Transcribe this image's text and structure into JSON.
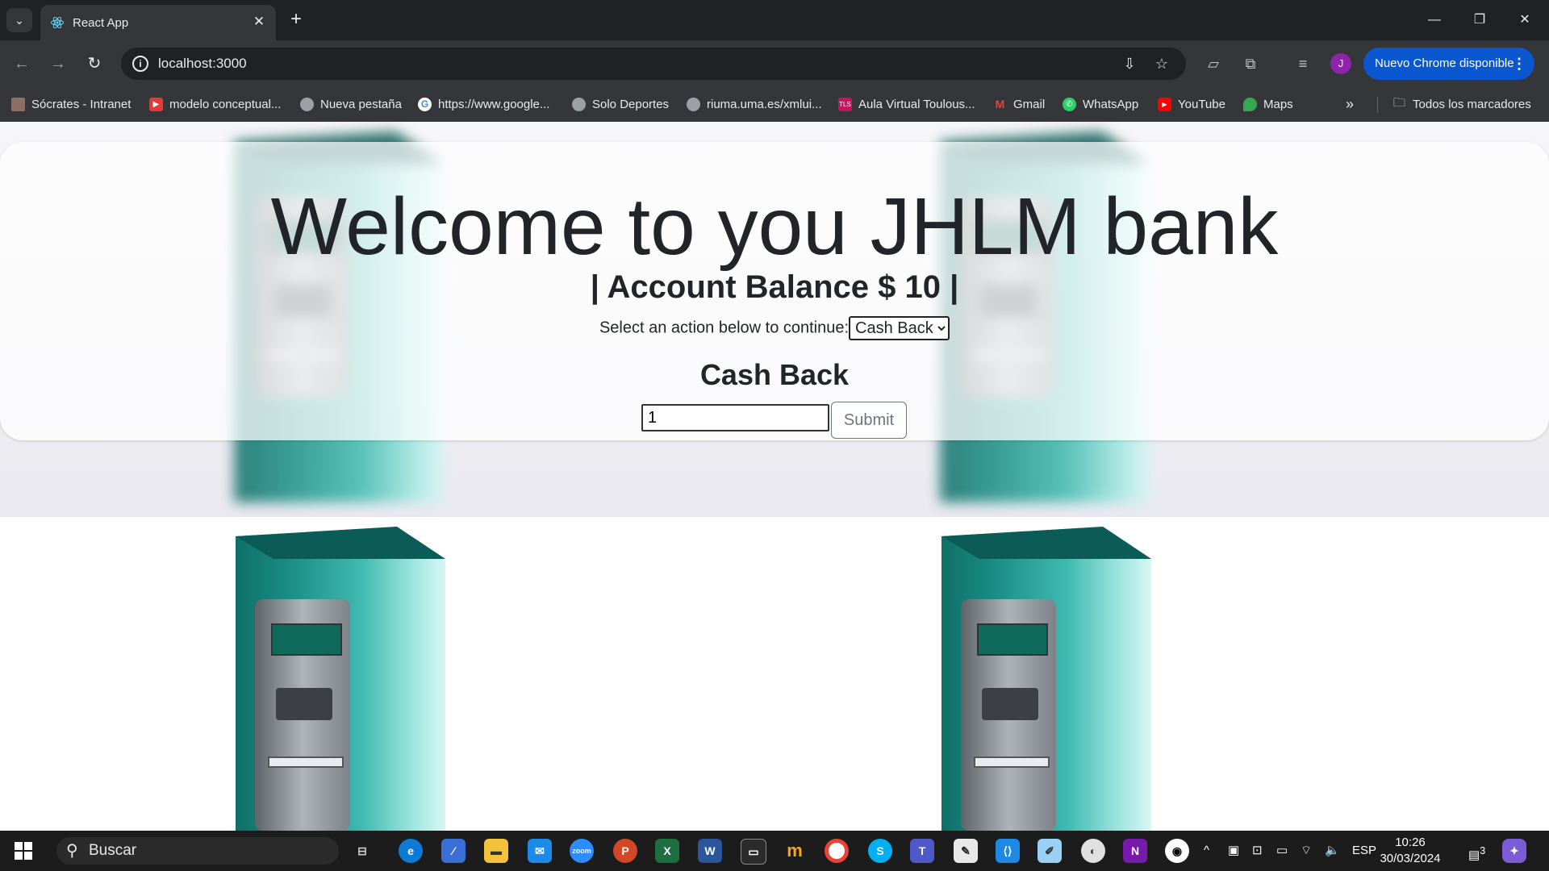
{
  "browser": {
    "tab_title": "React App",
    "url": "localhost:3000",
    "update_button": "Nuevo Chrome disponible",
    "profile_initial": "J",
    "bookmarks": [
      {
        "label": "Sócrates - Intranet",
        "color": "#8d6e63"
      },
      {
        "label": "modelo conceptual...",
        "color": "#e53935"
      },
      {
        "label": "Nueva pestaña",
        "color": "#9aa0a6"
      },
      {
        "label": "https://www.google...",
        "color": "#4285f4"
      },
      {
        "label": "Solo Deportes",
        "color": "#9aa0a6"
      },
      {
        "label": "riuma.uma.es/xmlui...",
        "color": "#9aa0a6"
      },
      {
        "label": "Aula Virtual Toulous...",
        "color": "#c2185b"
      },
      {
        "label": "Gmail",
        "color": "#ea4335"
      },
      {
        "label": "WhatsApp",
        "color": "#25d366"
      },
      {
        "label": "YouTube",
        "color": "#ff0000"
      },
      {
        "label": "Maps",
        "color": "#34a853"
      }
    ],
    "all_bookmarks": "Todos los marcadores"
  },
  "page": {
    "headline": "Welcome to you JHLM bank",
    "balance": "| Account Balance $ 10 |",
    "select_label": "Select an action below to continue:",
    "selected_action": "Cash Back",
    "section_title": "Cash Back",
    "amount_value": "1",
    "submit_label": "Submit"
  },
  "taskbar": {
    "search_placeholder": "Buscar",
    "language": "ESP",
    "time": "10:26",
    "date": "30/03/2024",
    "notifications": "3"
  }
}
